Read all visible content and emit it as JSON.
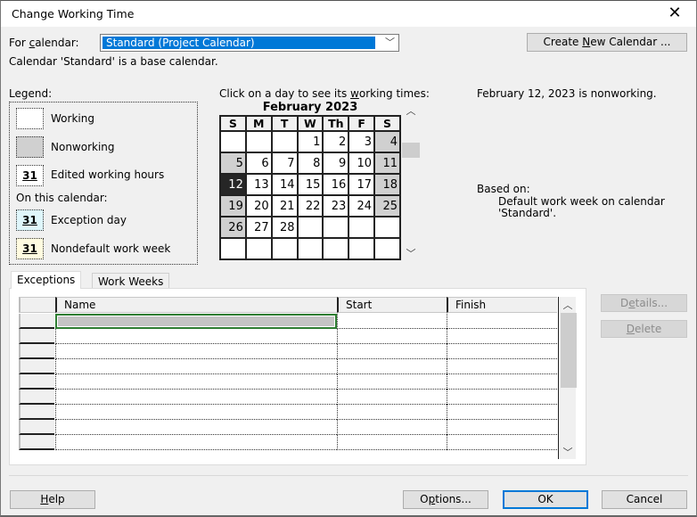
{
  "window": {
    "title": "Change Working Time",
    "close_icon": "close-x-icon"
  },
  "calendar_select": {
    "label_prefix": "For ",
    "label_accel": "c",
    "label_rest": "alendar:",
    "value": "Standard (Project Calendar)",
    "info": "Calendar 'Standard' is a base calendar."
  },
  "create_new_calendar": {
    "pre": "Create ",
    "accel": "N",
    "post": "ew Calendar ..."
  },
  "legend": {
    "title": "Legend:",
    "items": [
      {
        "label": "Working",
        "swatch": "",
        "color": "#ffffff"
      },
      {
        "label": "Nonworking",
        "swatch": "",
        "color": "#d0d0d0"
      },
      {
        "label": "Edited working hours",
        "swatch": "31",
        "color": "#ffffff"
      }
    ],
    "on_this_calendar": "On this calendar:",
    "calendar_items": [
      {
        "label": "Exception day",
        "swatch": "31",
        "color": "#dff6fb"
      },
      {
        "label": "Nondefault work week",
        "swatch": "31",
        "color": "#fffbe0"
      }
    ]
  },
  "month_calendar": {
    "instruction_pre": "Click on a day to see its ",
    "instruction_accel": "w",
    "instruction_post": "orking times:",
    "month_title": "February 2023",
    "weekdays": [
      "S",
      "M",
      "T",
      "W",
      "Th",
      "F",
      "S"
    ],
    "selected_day": 12,
    "weeks": [
      [
        {
          "d": "",
          "t": "empty"
        },
        {
          "d": "",
          "t": "empty"
        },
        {
          "d": "",
          "t": "empty"
        },
        {
          "d": "1",
          "t": "wk"
        },
        {
          "d": "2",
          "t": "wk"
        },
        {
          "d": "3",
          "t": "wk"
        },
        {
          "d": "4",
          "t": "nw"
        }
      ],
      [
        {
          "d": "5",
          "t": "nw"
        },
        {
          "d": "6",
          "t": "wk"
        },
        {
          "d": "7",
          "t": "wk"
        },
        {
          "d": "8",
          "t": "wk"
        },
        {
          "d": "9",
          "t": "wk"
        },
        {
          "d": "10",
          "t": "wk"
        },
        {
          "d": "11",
          "t": "nw"
        }
      ],
      [
        {
          "d": "12",
          "t": "sel"
        },
        {
          "d": "13",
          "t": "wk"
        },
        {
          "d": "14",
          "t": "wk"
        },
        {
          "d": "15",
          "t": "wk"
        },
        {
          "d": "16",
          "t": "wk"
        },
        {
          "d": "17",
          "t": "wk"
        },
        {
          "d": "18",
          "t": "nw"
        }
      ],
      [
        {
          "d": "19",
          "t": "nw"
        },
        {
          "d": "20",
          "t": "wk"
        },
        {
          "d": "21",
          "t": "wk"
        },
        {
          "d": "22",
          "t": "wk"
        },
        {
          "d": "23",
          "t": "wk"
        },
        {
          "d": "24",
          "t": "wk"
        },
        {
          "d": "25",
          "t": "nw"
        }
      ],
      [
        {
          "d": "26",
          "t": "nw"
        },
        {
          "d": "27",
          "t": "wk"
        },
        {
          "d": "28",
          "t": "wk"
        },
        {
          "d": "",
          "t": "empty"
        },
        {
          "d": "",
          "t": "empty"
        },
        {
          "d": "",
          "t": "empty"
        },
        {
          "d": "",
          "t": "empty"
        }
      ],
      [
        {
          "d": "",
          "t": "empty"
        },
        {
          "d": "",
          "t": "empty"
        },
        {
          "d": "",
          "t": "empty"
        },
        {
          "d": "",
          "t": "empty"
        },
        {
          "d": "",
          "t": "empty"
        },
        {
          "d": "",
          "t": "empty"
        },
        {
          "d": "",
          "t": "empty"
        }
      ]
    ],
    "scroll_up_icon": "chevron-up-icon",
    "scroll_down_icon": "chevron-down-icon"
  },
  "day_info": {
    "status": "February 12, 2023 is nonworking.",
    "based_on_label": "Based on:",
    "based_on_line1": "Default work week on calendar",
    "based_on_line2": "'Standard'."
  },
  "tabs": [
    {
      "label": "Exceptions",
      "active": true
    },
    {
      "label": "Work Weeks",
      "active": false
    }
  ],
  "exceptions_grid": {
    "columns": [
      "Name",
      "Start",
      "Finish"
    ],
    "rows": [
      {
        "name": "",
        "start": "",
        "finish": ""
      },
      {
        "name": "",
        "start": "",
        "finish": ""
      },
      {
        "name": "",
        "start": "",
        "finish": ""
      },
      {
        "name": "",
        "start": "",
        "finish": ""
      },
      {
        "name": "",
        "start": "",
        "finish": ""
      },
      {
        "name": "",
        "start": "",
        "finish": ""
      },
      {
        "name": "",
        "start": "",
        "finish": ""
      },
      {
        "name": "",
        "start": "",
        "finish": ""
      },
      {
        "name": "",
        "start": "",
        "finish": ""
      }
    ]
  },
  "side_buttons": {
    "details": {
      "pre": "D",
      "accel": "e",
      "post": "tails..."
    },
    "delete": {
      "pre": "",
      "accel": "D",
      "post": "elete"
    }
  },
  "footer": {
    "help": {
      "pre": "",
      "accel": "H",
      "post": "elp"
    },
    "options": {
      "pre": "O",
      "accel": "p",
      "post": "tions..."
    },
    "ok": "OK",
    "cancel": "Cancel"
  }
}
